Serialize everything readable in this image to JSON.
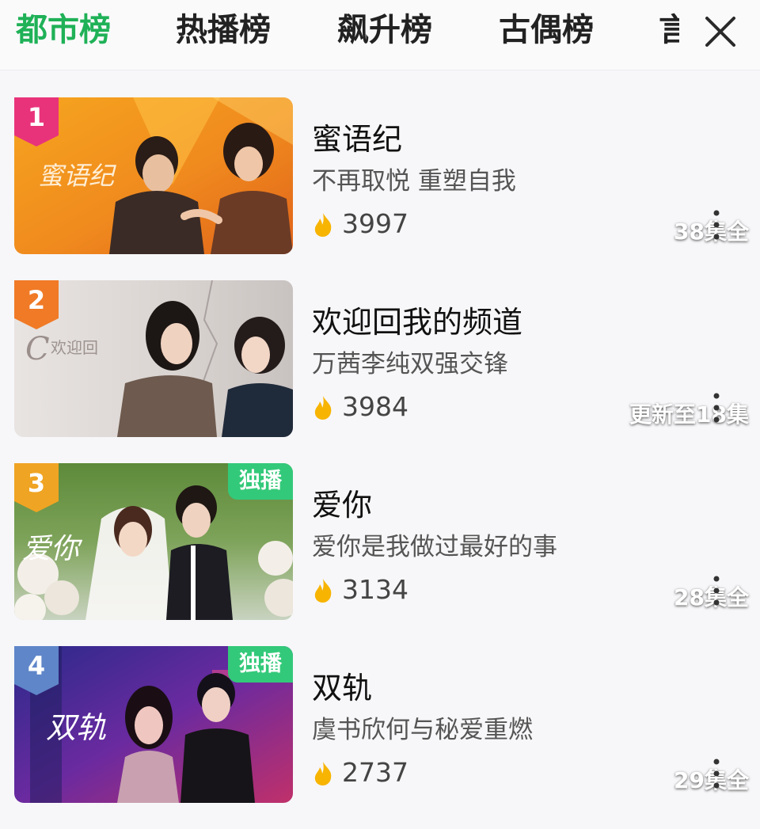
{
  "tabs": [
    {
      "label": "都市榜",
      "active": true
    },
    {
      "label": "热播榜",
      "active": false
    },
    {
      "label": "飙升榜",
      "active": false
    },
    {
      "label": "古偶榜",
      "active": false
    },
    {
      "label": "言",
      "active": false
    }
  ],
  "colors": {
    "accent": "#1fb157",
    "rank1": "#e8337a",
    "rank2": "#f07a26",
    "rank3": "#f0a423",
    "rank4": "#5f86c9",
    "exclusive_badge": "#33c97a",
    "heat_icon": "#f7b400"
  },
  "icons": {
    "close": "close-icon",
    "heat": "flame-icon",
    "more": "more-vertical-icon"
  },
  "items": [
    {
      "rank": "1",
      "title": "蜜语纪",
      "subtitle": "不再取悦 重塑自我",
      "heat": "3997",
      "episodes": "38集全",
      "exclusive": ""
    },
    {
      "rank": "2",
      "title": "欢迎回我的频道",
      "subtitle": "万茜李纯双强交锋",
      "heat": "3984",
      "episodes": "更新至18集",
      "exclusive": ""
    },
    {
      "rank": "3",
      "title": "爱你",
      "subtitle": "爱你是我做过最好的事",
      "heat": "3134",
      "episodes": "28集全",
      "exclusive": "独播"
    },
    {
      "rank": "4",
      "title": "双轨",
      "subtitle": "虞书欣何与秘爱重燃",
      "heat": "2737",
      "episodes": "29集全",
      "exclusive": "独播"
    }
  ]
}
